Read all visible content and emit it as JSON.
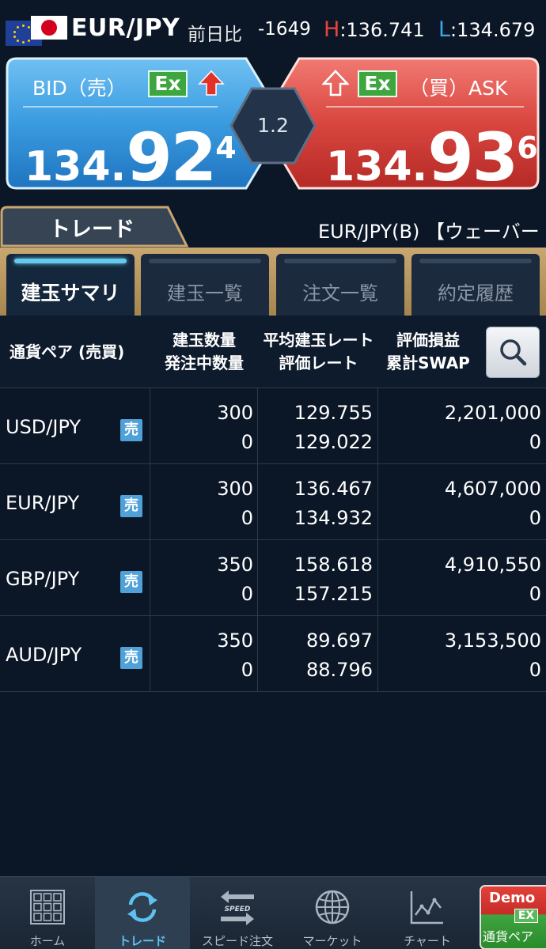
{
  "header": {
    "pair": "EUR/JPY",
    "change_label": "前日比",
    "change_value": "-1649",
    "high_label": "H",
    "high_value": ":136.741",
    "low_label": "L",
    "low_value": ":134.679"
  },
  "bid": {
    "label": "BID（売）",
    "ex": "Ex",
    "price_small": "134.",
    "price_large": "92",
    "price_sup": "4"
  },
  "ask": {
    "label": "（買）ASK",
    "ex": "Ex",
    "price_small": "134.",
    "price_large": "93",
    "price_sup": "6"
  },
  "spread": "1.2",
  "trade_tab": {
    "label": "トレード",
    "marquee": "EUR/JPY(B) 【ウェーバー"
  },
  "subtabs": [
    {
      "label": "建玉サマリ",
      "active": true
    },
    {
      "label": "建玉一覧",
      "active": false
    },
    {
      "label": "注文一覧",
      "active": false
    },
    {
      "label": "約定履歴",
      "active": false
    }
  ],
  "table": {
    "headers": {
      "pair": "通貨ペア (売買)",
      "qty1": "建玉数量",
      "qty2": "発注中数量",
      "rate1": "平均建玉レート",
      "rate2": "評価レート",
      "pl1": "評価損益",
      "pl2": "累計SWAP"
    },
    "rows": [
      {
        "pair": "USD/JPY",
        "side": "売",
        "qty": "300",
        "pending": "0",
        "avg_rate": "129.755",
        "eval_rate": "129.022",
        "pl": "2,201,000",
        "swap": "0"
      },
      {
        "pair": "EUR/JPY",
        "side": "売",
        "qty": "300",
        "pending": "0",
        "avg_rate": "136.467",
        "eval_rate": "134.932",
        "pl": "4,607,000",
        "swap": "0"
      },
      {
        "pair": "GBP/JPY",
        "side": "売",
        "qty": "350",
        "pending": "0",
        "avg_rate": "158.618",
        "eval_rate": "157.215",
        "pl": "4,910,550",
        "swap": "0"
      },
      {
        "pair": "AUD/JPY",
        "side": "売",
        "qty": "350",
        "pending": "0",
        "avg_rate": "89.697",
        "eval_rate": "88.796",
        "pl": "3,153,500",
        "swap": "0"
      }
    ]
  },
  "nav": [
    {
      "label": "ホーム",
      "icon": "home-grid-icon"
    },
    {
      "label": "トレード",
      "icon": "refresh-icon"
    },
    {
      "label": "スピード注文",
      "icon": "speed-icon"
    },
    {
      "label": "マーケット",
      "icon": "globe-icon"
    },
    {
      "label": "チャート",
      "icon": "chart-icon"
    }
  ],
  "demo": {
    "line1": "Demo",
    "line2": "EX",
    "line3": "通貨ペア"
  },
  "colors": {
    "bid": "#3a9be0",
    "ask": "#d9453f",
    "accent": "#65c9ee",
    "gold": "#c9a770"
  }
}
